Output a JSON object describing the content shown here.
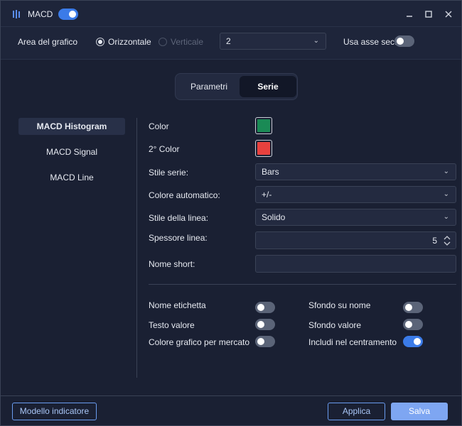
{
  "window": {
    "title": "MACD",
    "enabled": true
  },
  "toolbar": {
    "area_label": "Area del grafico",
    "radio_horizontal": "Orizzontale",
    "radio_vertical": "Verticale",
    "area_value": "2",
    "sec_axis_label": "Usa asse sec.",
    "sec_axis_on": false
  },
  "tabs": [
    {
      "label": "Parametri",
      "active": false
    },
    {
      "label": "Serie",
      "active": true
    }
  ],
  "nav": [
    {
      "label": "MACD Histogram",
      "active": true
    },
    {
      "label": "MACD Signal",
      "active": false
    },
    {
      "label": "MACD Line",
      "active": false
    }
  ],
  "form": {
    "color_label": "Color",
    "color_value": "#1a8a55",
    "color2_label": "2° Color",
    "color2_value": "#e8413e",
    "series_style_label": "Stile serie:",
    "series_style_value": "Bars",
    "auto_color_label": "Colore automatico:",
    "auto_color_value": "+/-",
    "line_style_label": "Stile della linea:",
    "line_style_value": "Solido",
    "line_width_label": "Spessore linea:",
    "line_width_value": "5",
    "short_name_label": "Nome short:",
    "short_name_value": ""
  },
  "toggles": {
    "label_name": {
      "label": "Nome etichetta",
      "on": false
    },
    "value_text": {
      "label": "Testo valore",
      "on": false
    },
    "market_color": {
      "label": "Colore grafico per mercato",
      "on": false
    },
    "name_bg": {
      "label": "Sfondo su nome",
      "on": false
    },
    "value_bg": {
      "label": "Sfondo valore",
      "on": false
    },
    "include_centering": {
      "label": "Includi nel centramento",
      "on": true
    }
  },
  "footer": {
    "template_button": "Modello indicatore",
    "apply_button": "Applica",
    "save_button": "Salva"
  },
  "colors": {
    "accent": "#3b7be8",
    "background": "#1a2033"
  }
}
